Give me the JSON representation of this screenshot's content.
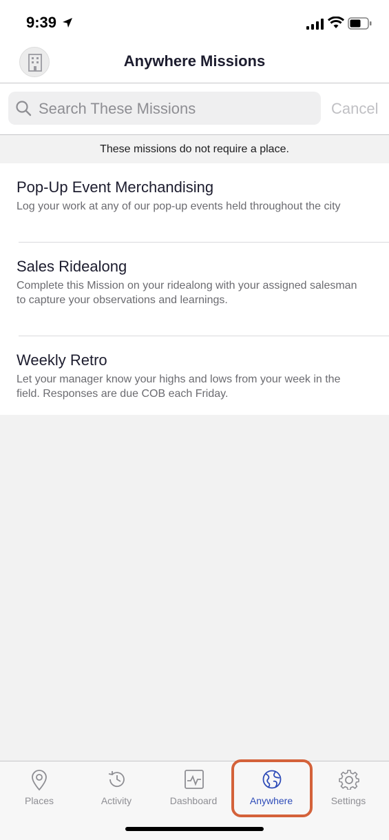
{
  "status_bar": {
    "time": "9:39"
  },
  "nav": {
    "title": "Anywhere Missions"
  },
  "search": {
    "placeholder": "Search These Missions",
    "value": "",
    "cancel_label": "Cancel"
  },
  "notice": "These missions do not require a place.",
  "missions": [
    {
      "title": "Pop-Up Event Merchandising",
      "description": "Log your work at any of our pop-up events held throughout the city"
    },
    {
      "title": "Sales Ridealong",
      "description": "Complete this Mission on your ridealong with your assigned salesman to capture your observations and learnings."
    },
    {
      "title": "Weekly Retro",
      "description": "Let your manager know your highs and lows from your week in the field. Responses are due COB each Friday."
    }
  ],
  "tabs": [
    {
      "label": "Places",
      "icon": "map-pin-icon"
    },
    {
      "label": "Activity",
      "icon": "history-icon"
    },
    {
      "label": "Dashboard",
      "icon": "dashboard-icon"
    },
    {
      "label": "Anywhere",
      "icon": "globe-icon",
      "active": true
    },
    {
      "label": "Settings",
      "icon": "gear-icon"
    }
  ],
  "colors": {
    "accent": "#2d4bb8",
    "highlight": "#d4623a",
    "inactive_tab": "#8e8e93"
  }
}
